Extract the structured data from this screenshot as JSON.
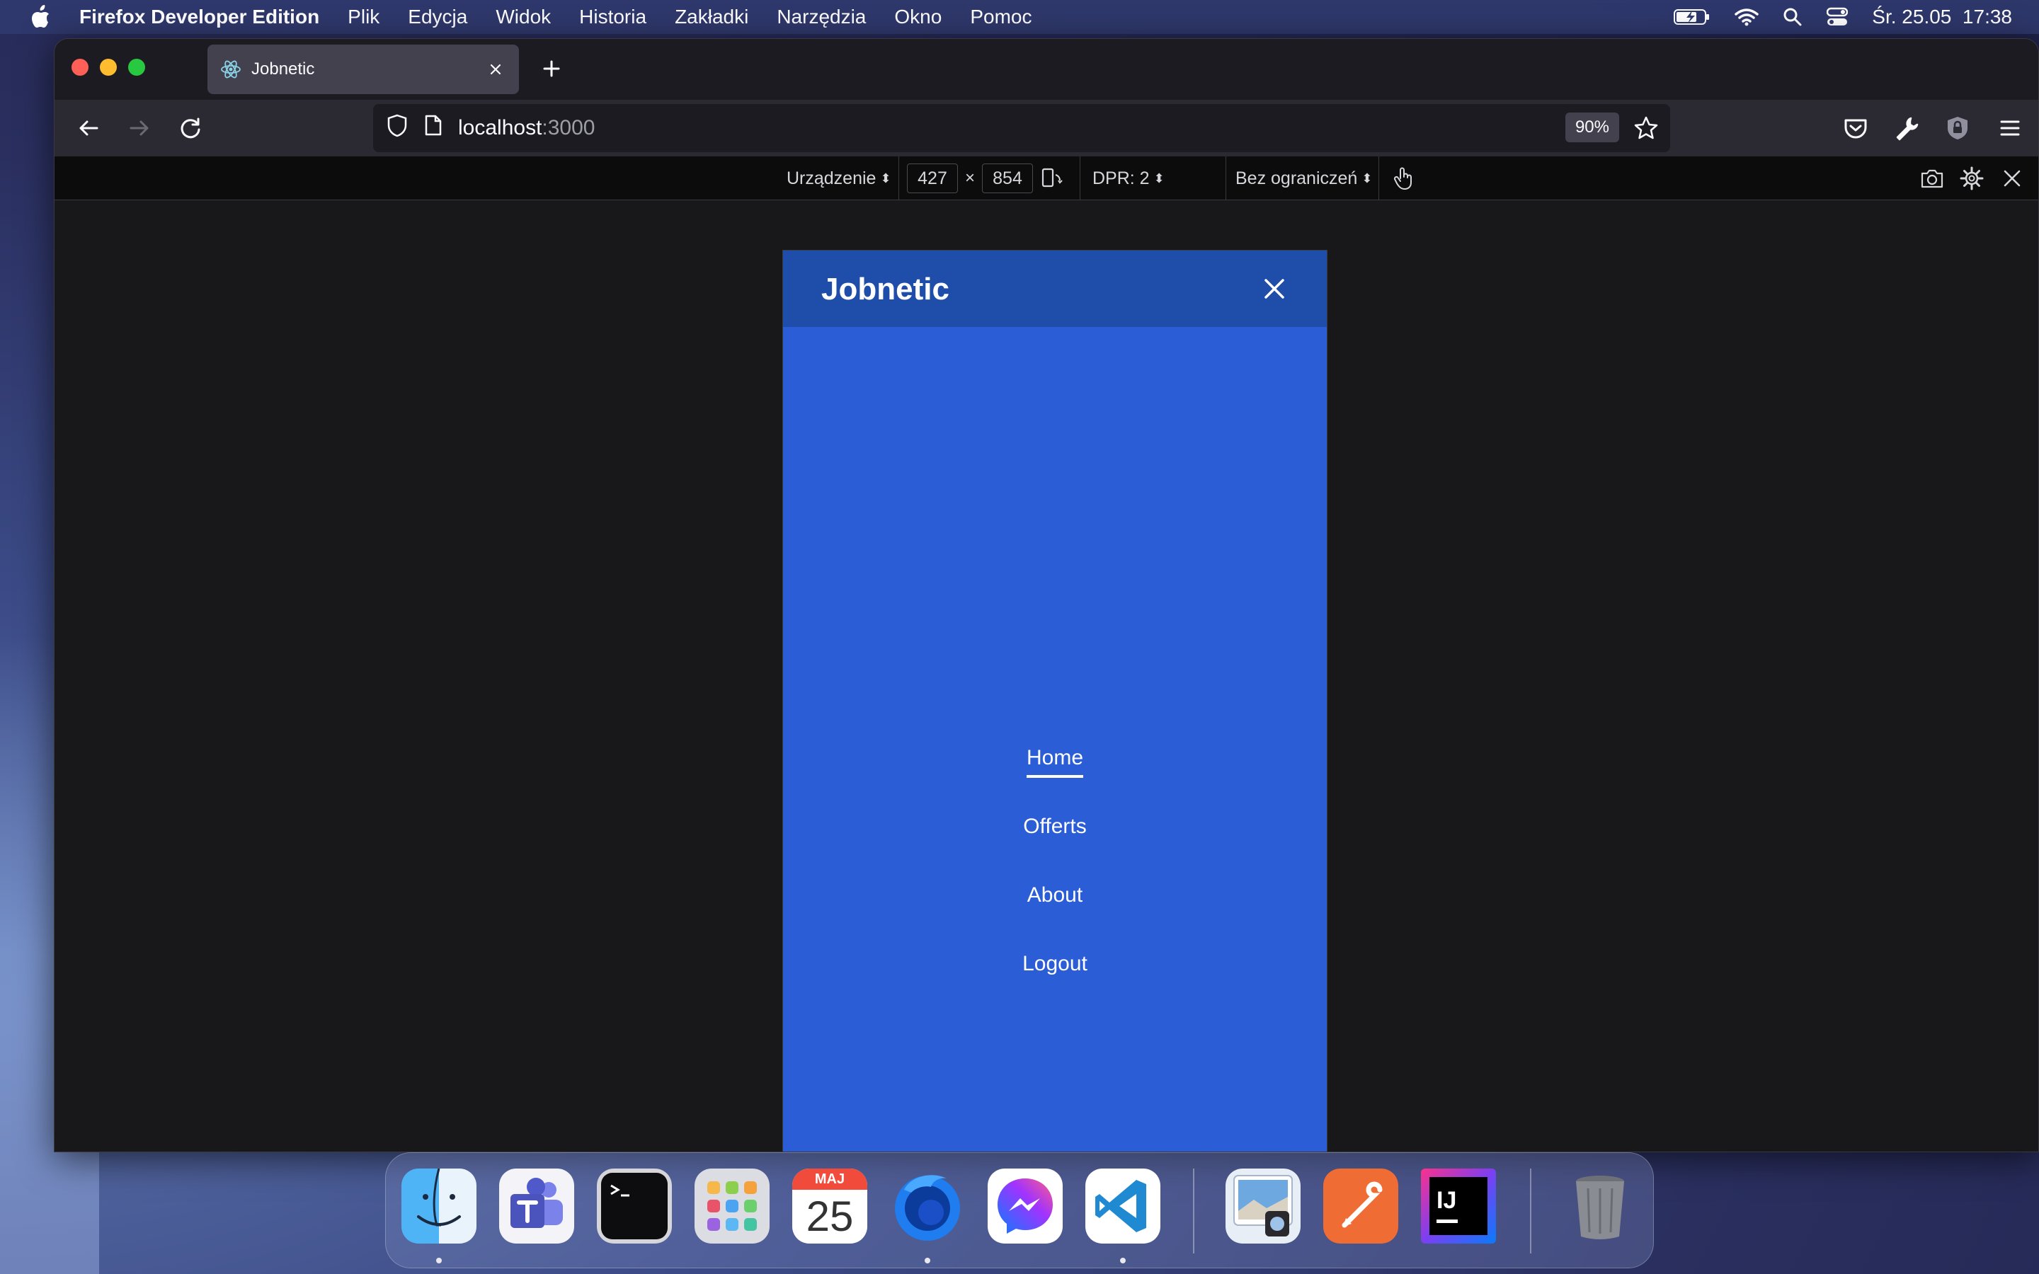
{
  "menubar": {
    "app_name": "Firefox Developer Edition",
    "items": [
      "Plik",
      "Edycja",
      "Widok",
      "Historia",
      "Zakładki",
      "Narzędzia",
      "Okno",
      "Pomoc"
    ],
    "datetime": "Śr. 25.05  17:38"
  },
  "browser": {
    "tab_title": "Jobnetic",
    "url_host": "localhost",
    "url_port": ":3000",
    "zoom": "90%"
  },
  "rdm": {
    "device_label": "Urządzenie",
    "width": "427",
    "times": "×",
    "height": "854",
    "dpr_label": "DPR: 2",
    "throttle_label": "Bez ograniczeń"
  },
  "app": {
    "brand": "Jobnetic",
    "nav": [
      {
        "label": "Home",
        "active": true
      },
      {
        "label": "Offerts",
        "active": false
      },
      {
        "label": "About",
        "active": false
      },
      {
        "label": "Logout",
        "active": false
      }
    ]
  },
  "dock": {
    "calendar_month": "MAJ",
    "calendar_day": "25",
    "items": [
      "finder-icon",
      "teams-icon",
      "terminal-icon",
      "launchpad-icon",
      "calendar-icon",
      "firefox-dev-icon",
      "messenger-icon",
      "vscode-icon",
      "preview-icon",
      "postman-icon",
      "intellij-icon",
      "trash-icon"
    ]
  },
  "colors": {
    "app_bg": "#2a5dd6",
    "app_header": "#1e4eaa",
    "browser_chrome": "#2b2a33"
  }
}
